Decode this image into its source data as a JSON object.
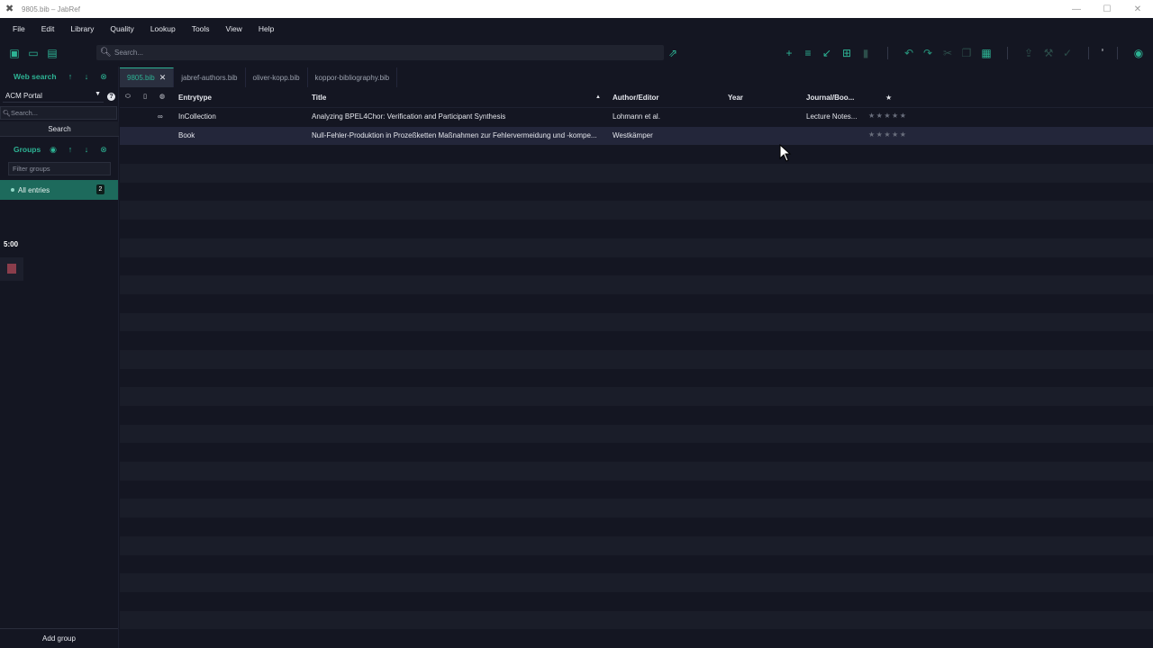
{
  "window": {
    "title": "9805.bib – JabRef"
  },
  "menubar": {
    "items": [
      "File",
      "Edit",
      "Library",
      "Quality",
      "Lookup",
      "Tools",
      "View",
      "Help"
    ]
  },
  "toolbar": {
    "search_placeholder": "Search..."
  },
  "sidebar": {
    "web_search_label": "Web search",
    "fetcher": "ACM Portal",
    "search_placeholder": "Search...",
    "search_button": "Search",
    "groups_label": "Groups",
    "filter_groups_placeholder": "Filter groups",
    "all_entries_label": "All entries",
    "all_entries_count": "2",
    "timer": "5:00",
    "add_group_label": "Add group"
  },
  "tabs": [
    {
      "label": "9805.bib",
      "active": true
    },
    {
      "label": "jabref-authors.bib",
      "active": false
    },
    {
      "label": "oliver-kopp.bib",
      "active": false
    },
    {
      "label": "koppor-bibliography.bib",
      "active": false
    }
  ],
  "table": {
    "columns": {
      "entrytype": "Entrytype",
      "title": "Title",
      "author": "Author/Editor",
      "year": "Year",
      "journal": "Journal/Boo...",
      "ranking": "★"
    },
    "rows": [
      {
        "entrytype": "InCollection",
        "title": "Analyzing BPEL4Chor: Verification and Participant Synthesis",
        "author": "Lohmann et al.",
        "year": "",
        "journal": "Lecture Notes...",
        "stars": "★★★★★",
        "has_link": true
      },
      {
        "entrytype": "Book",
        "title": "Null-Fehler-Produktion in Prozeßketten Maßnahmen zur Fehlervermeidung und -kompe...",
        "author": "Westkämper",
        "year": "",
        "journal": "",
        "stars": "★★★★★",
        "has_link": false
      }
    ]
  },
  "colors": {
    "accent": "#2db394",
    "background": "#141622",
    "selected_group": "#1d6a5c"
  }
}
